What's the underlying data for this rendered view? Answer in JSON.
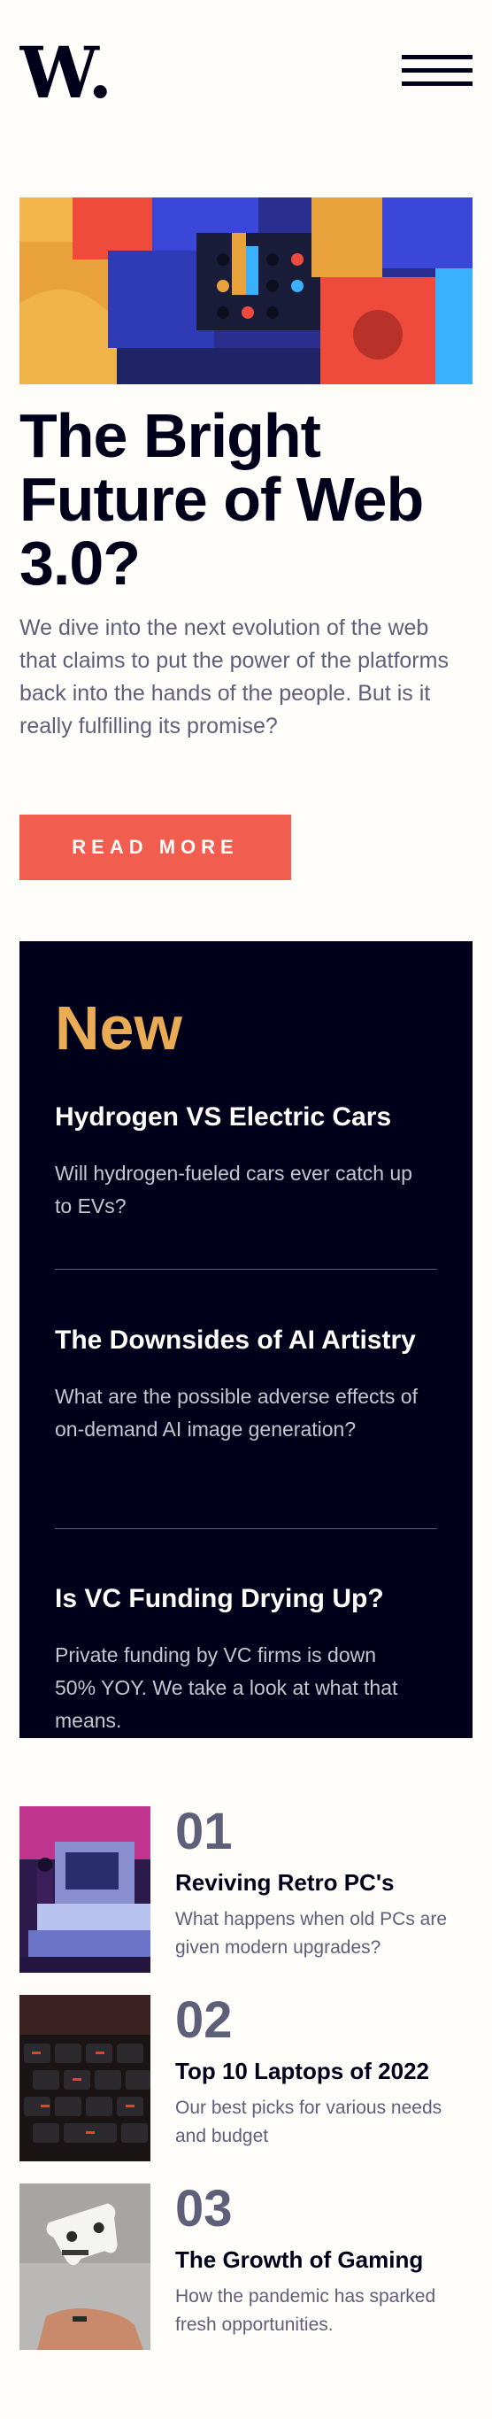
{
  "header": {
    "logo_text": "W.",
    "menu_icon": "hamburger-menu-icon"
  },
  "hero": {
    "image_icon": "colorful-3d-blocks-image",
    "title_lines": [
      "The Bright",
      "Future of Web",
      "3.0?"
    ],
    "description": "We dive into the next evolution of the web that claims to put the power of the platforms back into the hands of the people. But is it really fulfilling its promise?",
    "button_label": "READ MORE"
  },
  "new_section": {
    "heading": "New",
    "items": [
      {
        "title": "Hydrogen VS Electric Cars",
        "description": "Will hydrogen-fueled cars ever catch up to EVs?"
      },
      {
        "title": "The Downsides of AI Artistry",
        "description": "What are the possible adverse effects of on-demand AI image generation?"
      },
      {
        "title": "Is VC Funding Drying Up?",
        "description": "Private funding by VC firms is down 50% YOY. We take a look at what that means."
      }
    ]
  },
  "articles": [
    {
      "number": "01",
      "title": "Reviving Retro PC's",
      "description": "What happens when old PCs are given modern upgrades?",
      "image": "retro-pc-image"
    },
    {
      "number": "02",
      "title": "Top 10 Laptops of 2022",
      "description": "Our best picks for various needs and budget",
      "image": "laptop-keyboard-image"
    },
    {
      "number": "03",
      "title": "The Growth of Gaming",
      "description": "How the pandemic has sparked fresh opportunities.",
      "image": "game-controller-image"
    }
  ],
  "colors": {
    "accent_red": "#f15e50",
    "accent_orange": "#e9ab53",
    "dark_navy": "#00001a",
    "grayish_blue": "#5e607a",
    "off_white": "#fffdfa"
  }
}
